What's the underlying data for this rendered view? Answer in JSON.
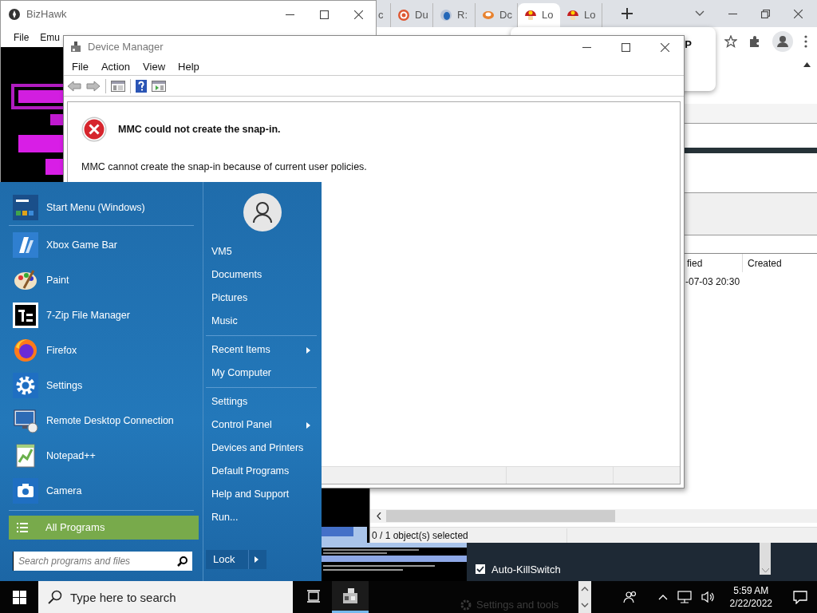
{
  "chrome": {
    "tabs": [
      {
        "label": "c",
        "selected": false
      },
      {
        "label": "Du",
        "selected": false
      },
      {
        "label": "R:",
        "selected": false
      },
      {
        "label": "Dc",
        "selected": false
      },
      {
        "label": "Lo",
        "selected": true
      },
      {
        "label": "Lo",
        "selected": false
      }
    ],
    "popup_text": "P"
  },
  "file_pane": {
    "columns": [
      "fied",
      "Created"
    ],
    "rows": [
      [
        "-07-03 20:30"
      ]
    ],
    "status": "0 / 1 object(s) selected"
  },
  "bizhawk": {
    "title": "BizHawk",
    "menu": [
      "File",
      "Emu"
    ]
  },
  "device_manager": {
    "title": "Device Manager",
    "menu": [
      "File",
      "Action",
      "View",
      "Help"
    ],
    "error_title": "MMC could not create the snap-in.",
    "error_message": "MMC cannot create the snap-in because of current user policies."
  },
  "vpn_panel": {
    "options": [
      {
        "label": "Auto-KillSwitch",
        "checked": true
      }
    ],
    "faded_item": "Settings and tools"
  },
  "start_menu": {
    "programs": [
      {
        "label": "Start Menu (Windows)"
      },
      {
        "label": "Xbox Game Bar"
      },
      {
        "label": "Paint"
      },
      {
        "label": "7-Zip File Manager"
      },
      {
        "label": "Firefox"
      },
      {
        "label": "Settings"
      },
      {
        "label": "Remote Desktop Connection"
      },
      {
        "label": "Notepad++"
      },
      {
        "label": "Camera"
      }
    ],
    "all_programs": "All Programs",
    "search": {
      "placeholder": "Search programs and files"
    },
    "places": [
      [
        {
          "label": "VM5",
          "submenu": false
        },
        {
          "label": "Documents",
          "submenu": false
        },
        {
          "label": "Pictures",
          "submenu": false
        },
        {
          "label": "Music",
          "submenu": false
        }
      ],
      [
        {
          "label": "Recent Items",
          "submenu": true
        },
        {
          "label": "My Computer",
          "submenu": false
        }
      ],
      [
        {
          "label": "Settings",
          "submenu": false
        },
        {
          "label": "Control Panel",
          "submenu": true
        },
        {
          "label": "Devices and Printers",
          "submenu": false
        },
        {
          "label": "Default Programs",
          "submenu": false
        },
        {
          "label": "Help and Support",
          "submenu": false
        },
        {
          "label": "Run...",
          "submenu": false
        }
      ]
    ],
    "power_button": "Lock"
  },
  "taskbar": {
    "search_placeholder": "Type here to search",
    "apps": [
      {
        "kind": "task-view",
        "active": false
      },
      {
        "kind": "device-manager",
        "active": true
      }
    ],
    "time": "5:59 AM",
    "date": "2/22/2022"
  }
}
